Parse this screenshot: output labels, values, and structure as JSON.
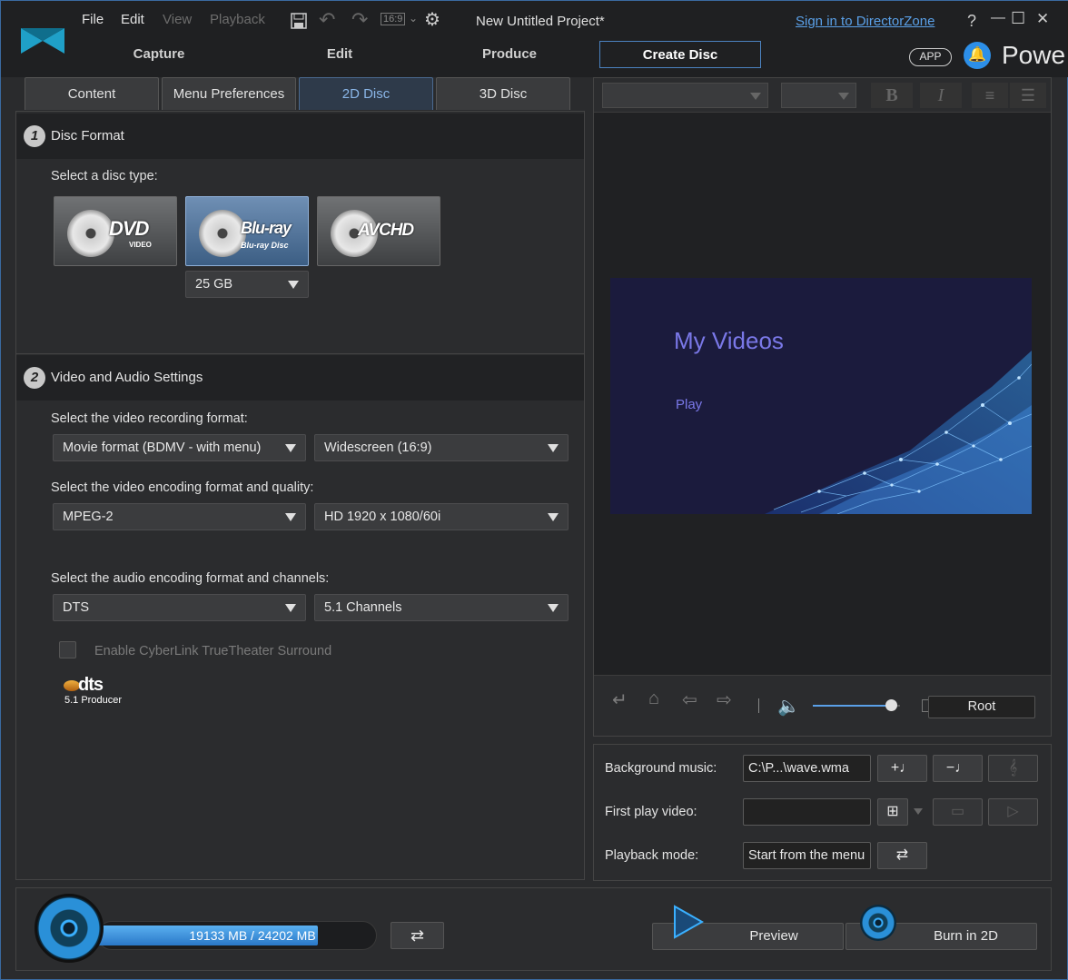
{
  "menu": {
    "file": "File",
    "edit": "Edit",
    "view": "View",
    "playback": "Playback"
  },
  "toolbar": {
    "aspect": "16:9"
  },
  "project_title": "New Untitled Project*",
  "sign_in": "Sign in to DirectorZone",
  "window_controls": {
    "help": "?",
    "minimize": "—",
    "maximize": "☐",
    "close": "✕"
  },
  "app_badge": "APP",
  "brand_partial": "Powe",
  "modes": [
    "Capture",
    "Edit",
    "Produce",
    "Create Disc"
  ],
  "subtabs": [
    "Content",
    "Menu Preferences",
    "2D Disc",
    "3D Disc"
  ],
  "disc_format": {
    "number": "1",
    "title": "Disc Format",
    "select_label": "Select a disc type:",
    "types": [
      {
        "name": "DVD",
        "sub": "VIDEO"
      },
      {
        "name": "Blu-ray",
        "sub": "Blu-ray Disc"
      },
      {
        "name": "AVCHD",
        "sub": ""
      }
    ],
    "capacity": "25 GB"
  },
  "va_settings": {
    "number": "2",
    "title": "Video and Audio Settings",
    "rec_label": "Select the video recording format:",
    "rec_format": "Movie format (BDMV - with menu)",
    "aspect": "Widescreen (16:9)",
    "enc_label": "Select the video encoding format and quality:",
    "encoding": "MPEG-2",
    "quality": "HD 1920 x 1080/60i",
    "audio_label": "Select the audio encoding format and channels:",
    "audio_format": "DTS",
    "channels": "5.1 Channels",
    "truetheater": "Enable CyberLink TrueTheater Surround",
    "dts_logo": "dts",
    "dts_sub": "5.1 Producer"
  },
  "menu_preview": {
    "title": "My Videos",
    "play": "Play"
  },
  "nav": {
    "root": "Root",
    "volume_level": 0.9
  },
  "settings": {
    "bg_music_label": "Background music:",
    "bg_music_value": "C:\\P...\\wave.wma",
    "first_play_label": "First play video:",
    "first_play_value": "",
    "playback_label": "Playback mode:",
    "playback_value": "Start from the menu"
  },
  "status": {
    "usage": "19133 MB / 24202 MB",
    "usage_fraction": 0.79
  },
  "actions": {
    "preview": "Preview",
    "burn": "Burn in 2D"
  },
  "colors": {
    "accent": "#4b82c0",
    "link": "#5aa0e8",
    "preview_text": "#7a78e8"
  }
}
